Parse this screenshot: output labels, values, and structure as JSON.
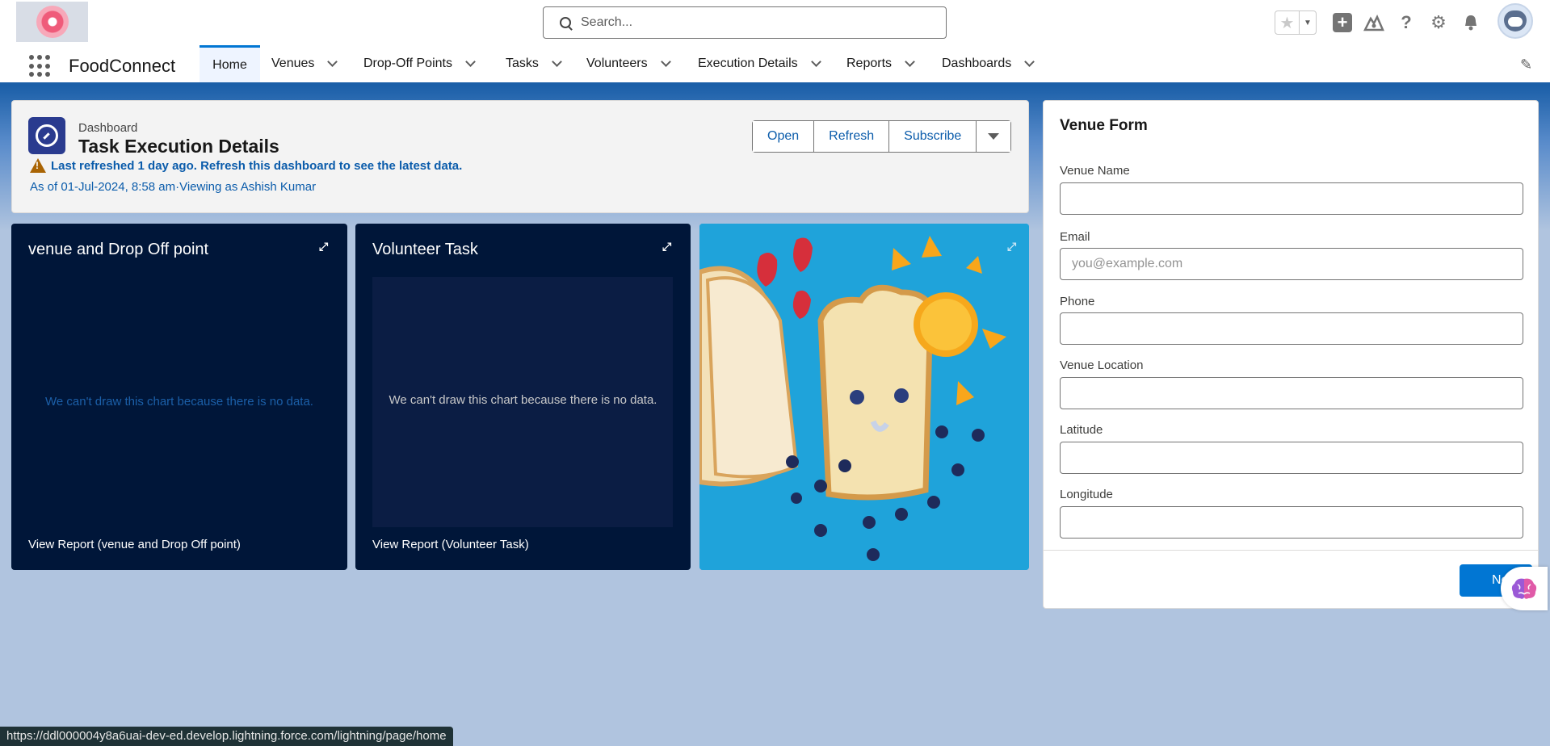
{
  "app": {
    "name": "FoodConnect"
  },
  "search": {
    "placeholder": "Search..."
  },
  "nav": {
    "tabs": [
      {
        "label": "Home"
      },
      {
        "label": "Venues"
      },
      {
        "label": "Drop-Off Points"
      },
      {
        "label": "Tasks"
      },
      {
        "label": "Volunteers"
      },
      {
        "label": "Execution Details"
      },
      {
        "label": "Reports"
      },
      {
        "label": "Dashboards"
      }
    ]
  },
  "dashboard": {
    "label": "Dashboard",
    "title": "Task Execution Details",
    "warning": "Last refreshed 1 day ago. Refresh this dashboard to see the latest data.",
    "as_of": "As of 01-Jul-2024, 8:58 am·Viewing as Ashish Kumar",
    "buttons": {
      "open": "Open",
      "refresh": "Refresh",
      "subscribe": "Subscribe"
    }
  },
  "widgets": [
    {
      "title": "venue and Drop Off point",
      "nodata": "We can't draw this chart because there is no data.",
      "link": "View Report (venue and Drop Off point)"
    },
    {
      "title": "Volunteer Task",
      "nodata": "We can't draw this chart because there is no data.",
      "link": "View Report (Volunteer Task)"
    }
  ],
  "form": {
    "title": "Venue Form",
    "fields": {
      "venue_name": {
        "label": "Venue Name",
        "value": "",
        "placeholder": ""
      },
      "email": {
        "label": "Email",
        "value": "",
        "placeholder": "you@example.com"
      },
      "phone": {
        "label": "Phone",
        "value": "",
        "placeholder": ""
      },
      "venue_location": {
        "label": "Venue Location",
        "value": "",
        "placeholder": ""
      },
      "latitude": {
        "label": "Latitude",
        "value": "",
        "placeholder": ""
      },
      "longitude": {
        "label": "Longitude",
        "value": "",
        "placeholder": ""
      }
    },
    "next_label": "Next"
  },
  "status_url": "https://ddl000004y8a6uai-dev-ed.develop.lightning.force.com/lightning/page/home",
  "colors": {
    "brand": "#0176d3",
    "widget_bg": "#001639",
    "page_bg": "#b0c4df",
    "warning": "#a96404",
    "link": "#0b5cab"
  }
}
